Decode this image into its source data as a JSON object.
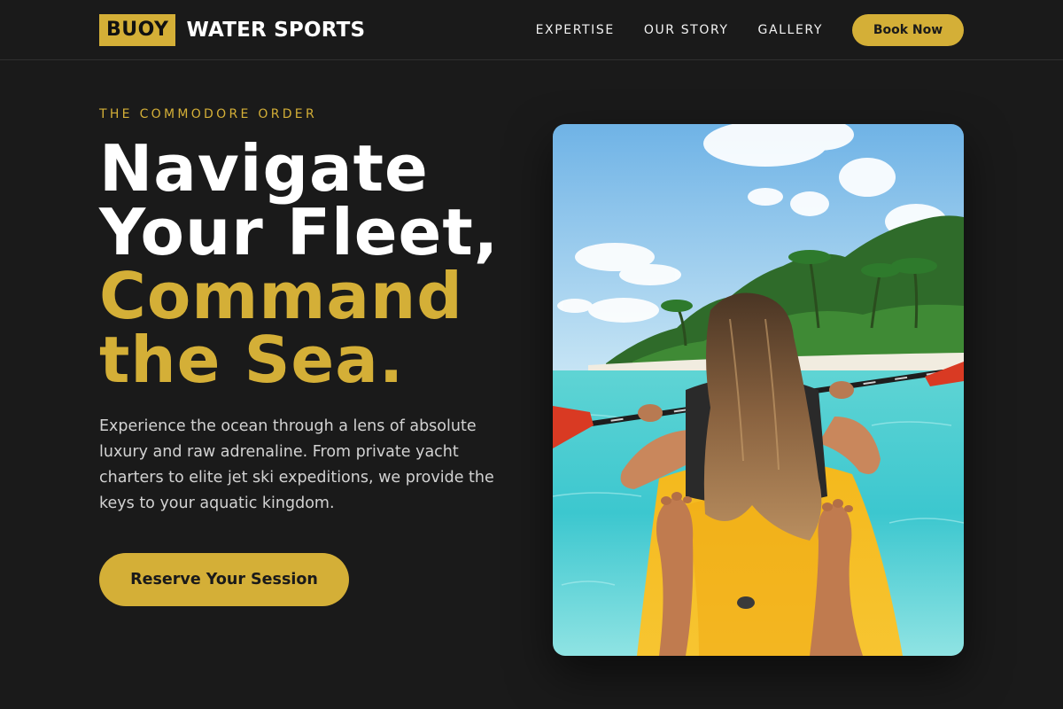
{
  "brand": {
    "badge": "BUOY",
    "name": "WATER SPORTS"
  },
  "nav": {
    "links": [
      "EXPERTISE",
      "OUR STORY",
      "GALLERY"
    ],
    "cta_label": "Book Now"
  },
  "hero": {
    "eyebrow": "THE COMMODORE ORDER",
    "headline_white": [
      "Navigate",
      "Your Fleet,"
    ],
    "headline_gold": [
      "Command",
      "the Sea."
    ],
    "description": "Experience the ocean through a lens of absolute luxury and raw adrenaline. From private yacht charters to elite jet ski expeditions, we provide the keys to your aquatic kingdom.",
    "cta_label": "Reserve Your Session",
    "image_subject": "woman-kayaking-tropical-island"
  },
  "colors": {
    "background": "#1a1a1a",
    "accent": "#d4af37",
    "text": "#ffffff",
    "muted_text": "#d2d2d2"
  }
}
